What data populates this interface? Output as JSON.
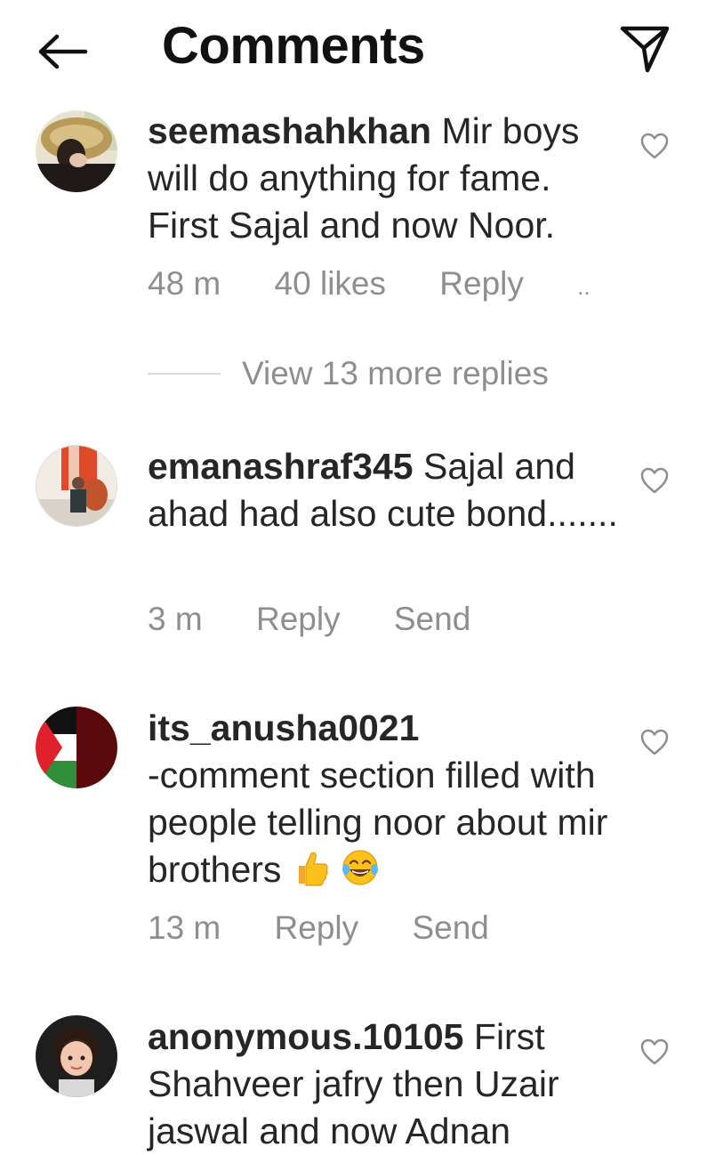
{
  "header": {
    "title": "Comments",
    "back_icon": "arrow-left-icon",
    "send_icon": "paper-plane-icon"
  },
  "comments": [
    {
      "username": "seemashahkhan",
      "text": "Mir boys will do anything for fame. First Sajal and now Noor.",
      "time": "48 m",
      "likes": "40 likes",
      "reply": "Reply",
      "more": "..",
      "view_replies": "View 13 more replies"
    },
    {
      "username": "emanashraf345",
      "text": "Sajal and ahad had also cute bond.......",
      "time": "3 m",
      "reply": "Reply",
      "send": "Send"
    },
    {
      "username": "its_anusha0021",
      "text": "-comment section filled with people telling noor about mir brothers",
      "emojis": [
        "thumbs-up-emoji",
        "tears-of-joy-emoji"
      ],
      "time": "13 m",
      "reply": "Reply",
      "send": "Send"
    },
    {
      "username": "anonymous.10105",
      "text": "First Shahveer jafry then Uzair jaswal and now Adnan"
    }
  ],
  "colors": {
    "text": "#262626",
    "secondary": "#8e8e8e",
    "divider": "#dbdbdb"
  }
}
